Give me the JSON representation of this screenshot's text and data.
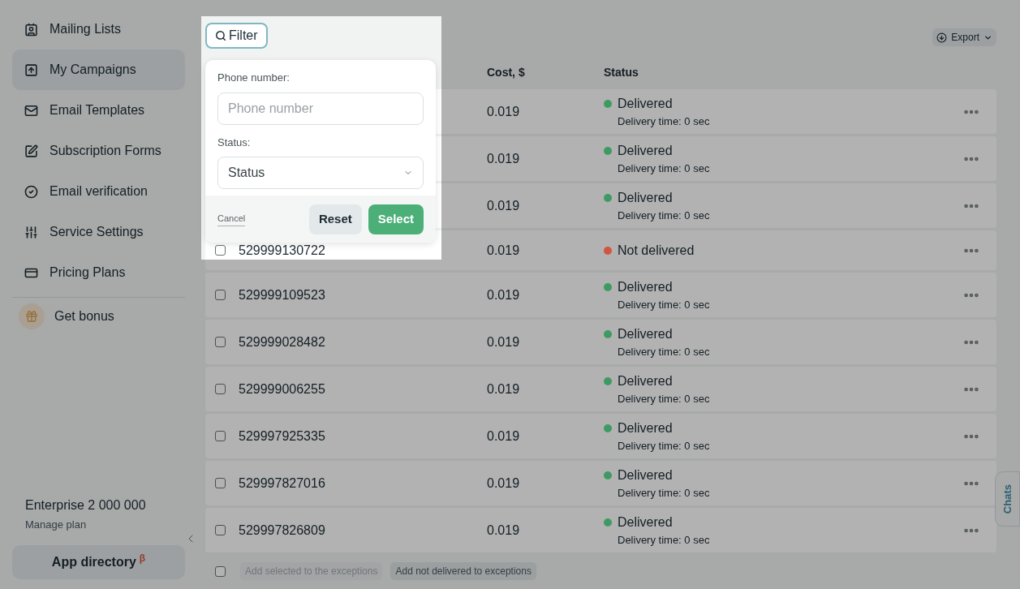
{
  "sidebar": {
    "items": [
      {
        "label": "Mailing Lists",
        "selected": false
      },
      {
        "label": "My Campaigns",
        "selected": true
      },
      {
        "label": "Email Templates",
        "selected": false
      },
      {
        "label": "Subscription Forms",
        "selected": false
      },
      {
        "label": "Email verification",
        "selected": false
      },
      {
        "label": "Service Settings",
        "selected": false
      },
      {
        "label": "Pricing Plans",
        "selected": false
      }
    ],
    "bonus": "Get bonus",
    "plan": {
      "name": "Enterprise 2 000 000",
      "link": "Manage plan"
    },
    "app_directory": {
      "label": "App directory",
      "badge": "β"
    }
  },
  "toolbar": {
    "filter": "Filter",
    "export": "Export"
  },
  "filter_popover": {
    "phone_label": "Phone number:",
    "phone_placeholder": "Phone number",
    "status_label": "Status:",
    "status_value": "Status",
    "cancel": "Cancel",
    "reset": "Reset",
    "select": "Select"
  },
  "table": {
    "columns": [
      "Cost, $",
      "Status"
    ],
    "rows": [
      {
        "cost": "0.019",
        "status": "Delivered",
        "color": "#3f9a62",
        "delivery_time": "Delivery time: 0 sec"
      },
      {
        "cost": "0.019",
        "status": "Delivered",
        "color": "#3f9a62",
        "delivery_time": "Delivery time: 0 sec"
      },
      {
        "cost": "0.019",
        "status": "Delivered",
        "color": "#3f9a62",
        "delivery_time": "Delivery time: 0 sec"
      },
      {
        "checked": false,
        "phone": "529999130722",
        "cost": "0.019",
        "status": "Not delivered",
        "color": "#d2553f"
      },
      {
        "checked": false,
        "phone": "529999109523",
        "cost": "0.019",
        "status": "Delivered",
        "color": "#3f9a62",
        "delivery_time": "Delivery time: 0 sec"
      },
      {
        "checked": false,
        "phone": "529999028482",
        "cost": "0.019",
        "status": "Delivered",
        "color": "#3f9a62",
        "delivery_time": "Delivery time: 0 sec"
      },
      {
        "checked": false,
        "phone": "529999006255",
        "cost": "0.019",
        "status": "Delivered",
        "color": "#3f9a62",
        "delivery_time": "Delivery time: 0 sec"
      },
      {
        "checked": false,
        "phone": "529997925335",
        "cost": "0.019",
        "status": "Delivered",
        "color": "#3f9a62",
        "delivery_time": "Delivery time: 0 sec"
      },
      {
        "checked": false,
        "phone": "529997827016",
        "cost": "0.019",
        "status": "Delivered",
        "color": "#3f9a62",
        "delivery_time": "Delivery time: 0 sec"
      },
      {
        "checked": false,
        "phone": "529997826809",
        "cost": "0.019",
        "status": "Delivered",
        "color": "#3f9a62",
        "delivery_time": "Delivery time: 0 sec"
      }
    ]
  },
  "bulk_actions": {
    "checked": false,
    "buttons": [
      {
        "label": "Add selected to the exceptions",
        "disabled": true
      },
      {
        "label": "Add not delivered to exceptions",
        "disabled": false
      }
    ]
  },
  "chats_tab": "Chats"
}
